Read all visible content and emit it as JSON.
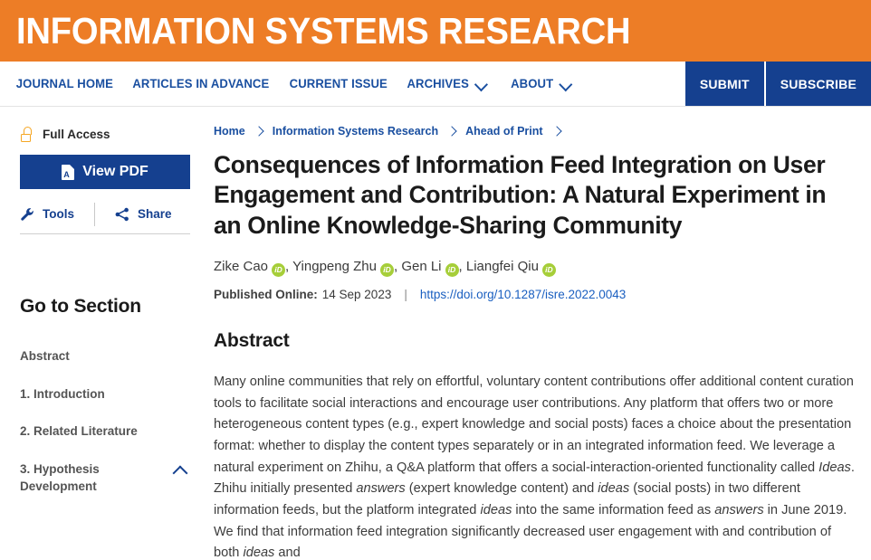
{
  "masthead": {
    "journal_title": "INFORMATION SYSTEMS RESEARCH",
    "bg_color": "#ED7D26"
  },
  "navbar": {
    "items": [
      {
        "label": "JOURNAL HOME",
        "has_chevron": false
      },
      {
        "label": "ARTICLES IN ADVANCE",
        "has_chevron": false
      },
      {
        "label": "CURRENT ISSUE",
        "has_chevron": false
      },
      {
        "label": "ARCHIVES",
        "has_chevron": true
      },
      {
        "label": "ABOUT",
        "has_chevron": true
      }
    ],
    "submit_label": "SUBMIT",
    "subscribe_label": "SUBSCRIBE",
    "button_color": "#15408f"
  },
  "sidebar": {
    "access_label": "Full Access",
    "access_icon": "open-lock-icon",
    "access_icon_color": "#f5a623",
    "view_pdf_label": "View PDF",
    "tools_label": "Tools",
    "share_label": "Share",
    "go_to_section_title": "Go to Section",
    "sections": [
      {
        "label": "Abstract",
        "expandable": false
      },
      {
        "label": "1. Introduction",
        "expandable": false
      },
      {
        "label": "2. Related Literature",
        "expandable": false
      },
      {
        "label": "3. Hypothesis Development",
        "expandable": true
      }
    ]
  },
  "breadcrumb": [
    "Home",
    "Information Systems Research",
    "Ahead of Print"
  ],
  "article": {
    "title": "Consequences of Information Feed Integration on User Engagement and Contribution: A Natural Experiment in an Online Knowledge-Sharing Community",
    "authors": [
      "Zike Cao",
      "Yingpeng Zhu",
      "Gen Li",
      "Liangfei Qiu"
    ],
    "orcid_badge_text": "iD",
    "orcid_color": "#a6ce39",
    "published_label": "Published Online:",
    "published_date": "14 Sep 2023",
    "separator": "|",
    "doi": "https://doi.org/10.1287/isre.2022.0043",
    "abstract_heading": "Abstract",
    "abstract_paragraph_html": "Many online communities that rely on effortful, voluntary content contributions offer additional content curation tools to facilitate social interactions and encourage user contributions. Any platform that offers two or more heterogeneous content types (e.g., expert knowledge and social posts) faces a choice about the presentation format: whether to display the content types separately or in an integrated information feed. We leverage a natural experiment on Zhihu, a Q&amp;A platform that offers a social-interaction-oriented functionality called <i>Ideas</i>. Zhihu initially presented <i>answers</i> (expert knowledge content) and <i>ideas</i> (social posts) in two different information feeds, but the platform integrated <i>ideas</i> into the same information feed as <i>answers</i> in June 2019. We find that information feed integration significantly decreased user engagement with and contribution of both <i>ideas</i> and"
  }
}
